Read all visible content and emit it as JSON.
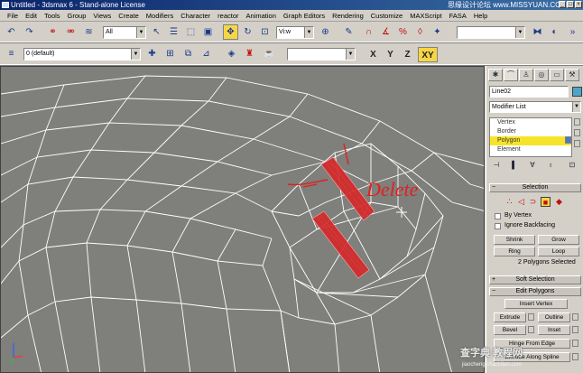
{
  "window": {
    "title": "Untitled - 3dsmax 6 - Stand-alone License",
    "watermark": "思缘设计论坛 www.MISSYUAN.COM"
  },
  "menu": [
    "File",
    "Edit",
    "Tools",
    "Group",
    "Views",
    "Create",
    "Modifiers",
    "Character",
    "reactor",
    "Animation",
    "Graph Editors",
    "Rendering",
    "Customize",
    "MAXScript",
    "FASA",
    "Help"
  ],
  "toolbar": {
    "selection_filter": "All",
    "reference_coord": "Vi:w",
    "named_selection": "",
    "layer": "0 (default)",
    "axis": [
      "X",
      "Y",
      "Z",
      "XY"
    ],
    "active_axis": "XY"
  },
  "annotation": {
    "text": "Delete",
    "color": "#e02020"
  },
  "command_panel": {
    "object_name": "Line02",
    "object_color": "#4da6c8",
    "modifier_list": "Modifier List",
    "stack": [
      "Vertex",
      "Border",
      "Polygon",
      "Element"
    ],
    "stack_selected": "Polygon",
    "rollout_selection": "Selection",
    "by_vertex": "By Vertex",
    "ignore_backfacing": "Ignore Backfacing",
    "shrink": "Shrink",
    "grow": "Grow",
    "ring": "Ring",
    "loop": "Loop",
    "status": "2 Polygons Selected",
    "rollout_soft": "Soft Selection",
    "rollout_edit": "Edit Polygons",
    "insert_vertex": "Insert Vertex",
    "extrude": "Extrude",
    "outline": "Outline",
    "bevel": "Bevel",
    "inset": "Inset",
    "hinge_from_edge": "Hinge From Edge",
    "extrude_along_spline": "Extrude Along Spline"
  },
  "site_watermark": {
    "name": "查字典 教程网",
    "url": "jiaocheng.chazidian.com"
  }
}
